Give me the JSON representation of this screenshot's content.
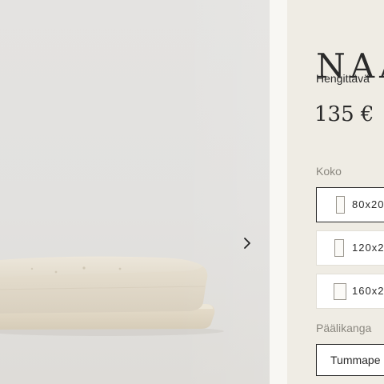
{
  "product": {
    "title": "NAA",
    "subtitle": "Hengittävä",
    "price": "135 €"
  },
  "gallery": {
    "image_name": "futon-mattress-photo",
    "next_icon": "chevron-right-icon"
  },
  "size": {
    "label": "Koko",
    "options": [
      {
        "label": "80x20",
        "selected": true
      },
      {
        "label": "120x2",
        "selected": false
      },
      {
        "label": "160x2",
        "selected": false
      }
    ]
  },
  "fabric": {
    "label": "Päälikanga",
    "selected": "Tummape"
  },
  "colors": {
    "panel_bg": "#efece4",
    "text": "#2a2a2a",
    "muted": "#8a877f",
    "mattress": "#ebe3d4"
  }
}
